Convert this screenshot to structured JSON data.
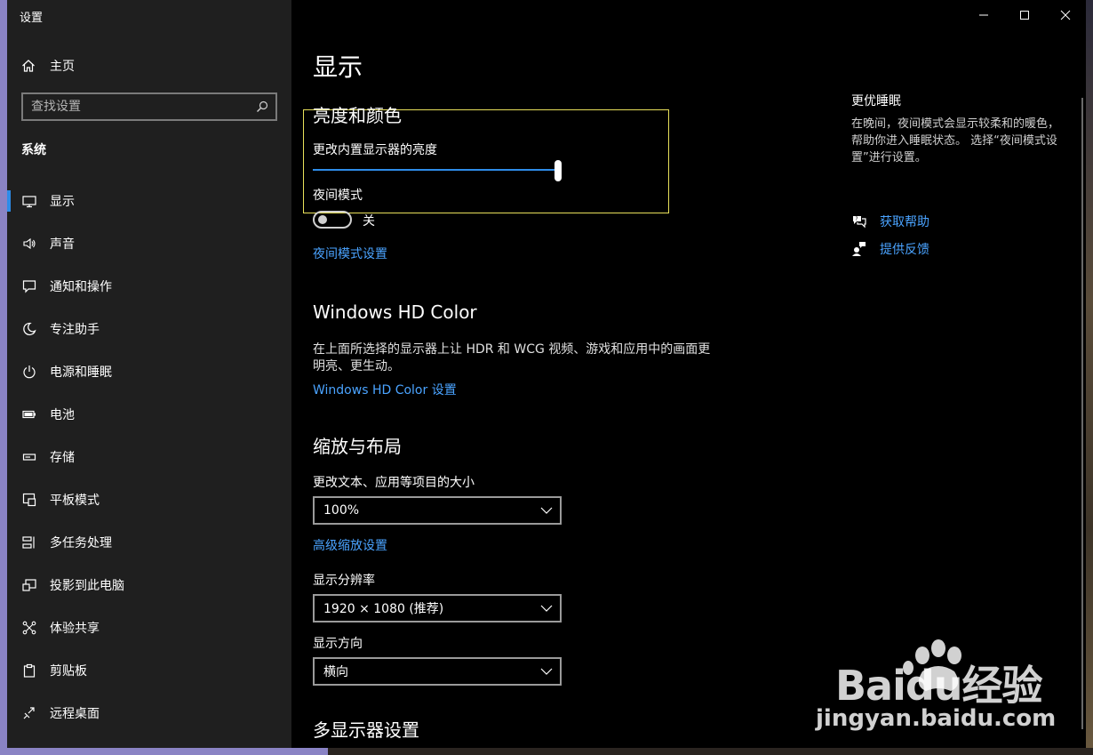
{
  "window": {
    "title": "设置"
  },
  "sidebar": {
    "home": "主页",
    "search_placeholder": "查找设置",
    "section": "系统",
    "items": [
      {
        "label": "显示",
        "icon": "monitor-icon"
      },
      {
        "label": "声音",
        "icon": "speaker-icon"
      },
      {
        "label": "通知和操作",
        "icon": "notification-icon"
      },
      {
        "label": "专注助手",
        "icon": "moon-icon"
      },
      {
        "label": "电源和睡眠",
        "icon": "power-icon"
      },
      {
        "label": "电池",
        "icon": "battery-icon"
      },
      {
        "label": "存储",
        "icon": "storage-icon"
      },
      {
        "label": "平板模式",
        "icon": "tablet-icon"
      },
      {
        "label": "多任务处理",
        "icon": "multitask-icon"
      },
      {
        "label": "投影到此电脑",
        "icon": "project-icon"
      },
      {
        "label": "体验共享",
        "icon": "share-icon"
      },
      {
        "label": "剪贴板",
        "icon": "clipboard-icon"
      },
      {
        "label": "远程桌面",
        "icon": "remote-icon"
      }
    ]
  },
  "main": {
    "title": "显示",
    "brightness": {
      "heading": "亮度和颜色",
      "label": "更改内置显示器的亮度",
      "value": 100
    },
    "night": {
      "label": "夜间模式",
      "state": "关",
      "link": "夜间模式设置"
    },
    "hdr": {
      "heading": "Windows HD Color",
      "desc_line1": "在上面所选择的显示器上让 HDR 和 WCG 视频、游戏和应用中的画面更",
      "desc_line2": "明亮、更生动。",
      "link": "Windows HD Color 设置"
    },
    "scale": {
      "heading": "缩放与布局",
      "size_label": "更改文本、应用等项目的大小",
      "size_value": "100%",
      "advanced_link": "高级缩放设置",
      "resolution_label": "显示分辨率",
      "resolution_value": "1920 × 1080 (推荐)",
      "orientation_label": "显示方向",
      "orientation_value": "横向"
    },
    "multi": {
      "heading": "多显示器设置"
    }
  },
  "right_panel": {
    "title": "更优睡眠",
    "desc": "在晚间，夜间模式会显示较柔和的暖色，帮助你进入睡眠状态。 选择“夜间模式设置”进行设置。",
    "help": "获取帮助",
    "feedback": "提供反馈"
  },
  "watermark": {
    "brand": "Baidu经验",
    "url": "jingyan.baidu.com"
  },
  "colors": {
    "accent": "#2e8ce8",
    "link": "#4aa3ff",
    "highlight_box": "#e8e05a"
  }
}
